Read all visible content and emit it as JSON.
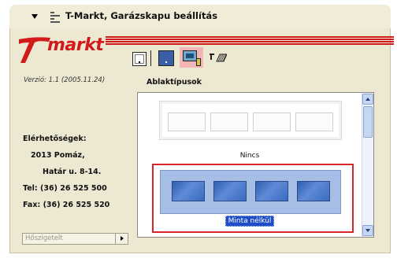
{
  "window": {
    "title": "T-Markt, Garázskapu beállítás"
  },
  "brand": {
    "logo_text": "markt",
    "accent_color": "#d11a1a"
  },
  "toolbar": {
    "items": [
      {
        "icon": "garage-door-icon",
        "selected": false
      },
      {
        "icon": "garage-door-blue-icon",
        "selected": false
      },
      {
        "icon": "window-panel-icon",
        "selected": true
      },
      {
        "icon": "handle-accessory-icon",
        "selected": false
      }
    ]
  },
  "info": {
    "version": "Verzió: 1.1 (2005.11.24)",
    "contact_heading": "Elérhetőségek:",
    "city": "2013 Pomáz,",
    "street": "Határ u. 8-14.",
    "phone": "Tel:  (36) 26 525 500",
    "fax": "Fax:  (36) 26 525 520"
  },
  "insulation_select": {
    "value": "Hőszigetelt"
  },
  "window_types": {
    "heading": "Ablaktípusok",
    "items": [
      {
        "label": "Nincs",
        "selected": false
      },
      {
        "label": "Minta nélkül",
        "selected": true
      }
    ]
  }
}
